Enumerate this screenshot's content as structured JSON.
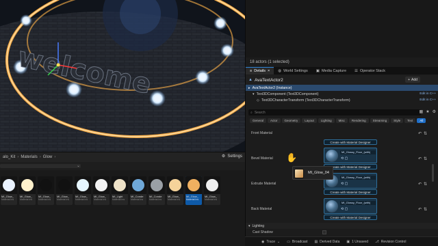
{
  "viewport": {
    "scene_text": "welcome"
  },
  "content_browser": {
    "path": [
      "alo_Kit",
      "Materials",
      "Glow"
    ],
    "settings_label": "Settings",
    "assets": [
      {
        "name": "MI_Glow_",
        "sub": "Material Ins",
        "thumb": "#eaf3ff"
      },
      {
        "name": "MI_Glow_",
        "sub": "Material Ins",
        "thumb": "#fff1cc"
      },
      {
        "name": "MI_Glow_",
        "sub": "Material Ins",
        "thumb": "#111111"
      },
      {
        "name": "MI_Glow_",
        "sub": "Material Ins",
        "thumb": "#111111"
      },
      {
        "name": "MI_Glow_",
        "sub": "Material Ins",
        "thumb": "#e6f6ff"
      },
      {
        "name": "MI_Glow_",
        "sub": "Material Ins",
        "thumb": "#f2f2f2"
      },
      {
        "name": "MI_Light",
        "sub": "Material Ins",
        "thumb": "#efe3c8"
      },
      {
        "name": "MI_Conde",
        "sub": "Material Ins",
        "thumb": "#6fa8d8"
      },
      {
        "name": "MI_Conde",
        "sub": "Material Ins",
        "thumb": "#9aa0a6"
      },
      {
        "name": "MI_Glow_",
        "sub": "Material Ins",
        "thumb": "#f5d39a"
      },
      {
        "name": "MI_Glow_",
        "sub": "Material Ins",
        "thumb": "#f0b060",
        "selected": true
      },
      {
        "name": "MI_Glow_",
        "sub": "Material Ins",
        "thumb": "#efefef"
      }
    ]
  },
  "outliner": {
    "actors_count": "18 actors (1 selected)"
  },
  "tabs": [
    {
      "label": "Details",
      "active": true
    },
    {
      "label": "World Settings"
    },
    {
      "label": "Media Capture"
    },
    {
      "label": "Operator Stack"
    }
  ],
  "details": {
    "actor_name": "AvaTextActor2",
    "add_label": "Add",
    "components": [
      {
        "label": "AvaTextActor2 (Instance)",
        "edit": "",
        "selected": true
      },
      {
        "label": "Text3DComponent (Text3DComponent)",
        "edit": "Edit in C++"
      },
      {
        "label": "Text3DCharacterTransform (Text3DCharacterTransform)",
        "edit": "Edit in C++"
      }
    ],
    "search_placeholder": "Search",
    "filters": [
      "General",
      "Actor",
      "Geometry",
      "Layout",
      "Lighting",
      "Misc",
      "Rendering",
      "Streaming",
      "Style",
      "Text",
      "All"
    ],
    "active_filter": "All",
    "materials": [
      {
        "label": "Front Material",
        "material": "MI_Glossy_Floor_(with)",
        "create": "Create with Material Designer"
      },
      {
        "label": "Bevel Material",
        "material": "MI_Glossy_Floor_(with)",
        "create": "Create with Material Designer"
      },
      {
        "label": "Extrude Material",
        "material": "MI_Glossy_Floor_(with)",
        "create": "Create with Material Designer"
      },
      {
        "label": "Back Material",
        "material": "MI_Glossy_Floor_(with)",
        "create": "Create with Material Designer"
      }
    ],
    "lighting_section": "Lighting",
    "cast_shadow": "Cast Shadow"
  },
  "drag": {
    "asset_name": "MI_Glow_04"
  },
  "statusbar": {
    "trace": "Trace",
    "broadcast": "Broadcast",
    "derived": "Derived Data",
    "unsaved": "1 Unsaved",
    "revision": "Revision Control"
  },
  "colors": {
    "accent": "#1f6fc9",
    "selection": "#2b4a6e",
    "glow": "#ffb24a"
  }
}
